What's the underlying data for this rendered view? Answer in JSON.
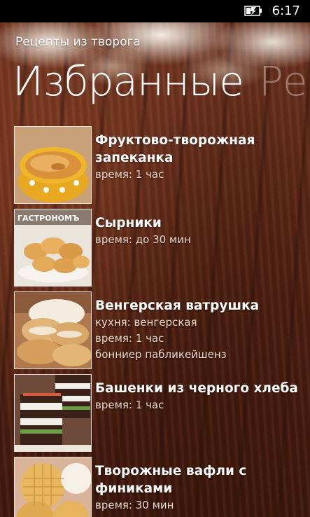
{
  "status_bar": {
    "time": "6:17",
    "battery_icon": "battery-charging-icon"
  },
  "app": {
    "title": "Рецепты из творога"
  },
  "pivot": {
    "active": "Избранные",
    "next": "Ре"
  },
  "recipes": [
    {
      "title_lines": [
        "Фруктово-творожная",
        "запеканка"
      ],
      "meta": [
        "время: 1 час"
      ],
      "thumb": "casserole"
    },
    {
      "title_lines": [
        "Сырники"
      ],
      "meta": [
        "время: до 30 мин"
      ],
      "thumb": "syrniki",
      "thumb_watermark": "ГАСТРОНОМЪ"
    },
    {
      "title_lines": [
        "Венгерская ватрушка"
      ],
      "meta": [
        "кухня: венгерская",
        "время: 1 час",
        "бонниер пабликейшенз"
      ],
      "thumb": "pastry"
    },
    {
      "title_lines": [
        "Башенки из черного хлеба"
      ],
      "meta": [
        "время: 1 час"
      ],
      "thumb": "bread-towers"
    },
    {
      "title_lines": [
        "Творожные вафли  с",
        "финиками"
      ],
      "meta": [
        "время: 30 мин"
      ],
      "thumb": "waffles"
    }
  ],
  "colors": {
    "background_wood": "#5a2616",
    "text_primary": "#ffffff",
    "text_secondary": "#e8d8cc",
    "pivot_inactive": "rgba(255,255,255,0.35)"
  }
}
